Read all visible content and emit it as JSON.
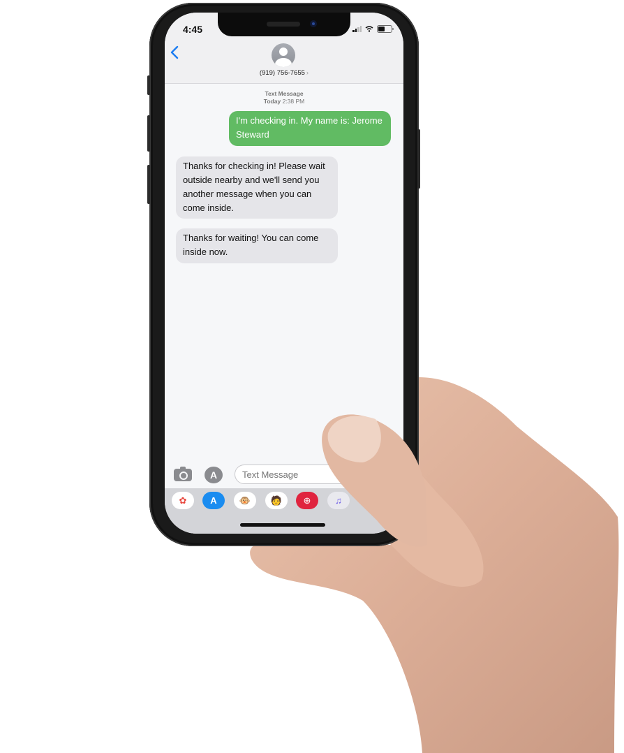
{
  "status_bar": {
    "time": "4:45",
    "signal_bars": 2,
    "battery_level": 0.5
  },
  "header": {
    "back_icon": "chevron-left-icon",
    "contact_icon": "person-avatar-icon",
    "contact_name": "(919) 756-7655",
    "contact_chevron": "›"
  },
  "conversation": {
    "meta_label": "Text Message",
    "meta_day": "Today",
    "meta_time": "2:38 PM",
    "messages": [
      {
        "direction": "outgoing",
        "text": "I'm checking in. My name is: Jerome Steward"
      },
      {
        "direction": "incoming",
        "text": "Thanks for checking in! Please wait outside nearby and we'll send you another message when you can come inside."
      },
      {
        "direction": "incoming",
        "text": "Thanks for waiting! You can come inside now."
      }
    ]
  },
  "composer": {
    "camera_icon": "camera-icon",
    "apps_icon": "app-store-icon",
    "apps_glyph": "A",
    "placeholder": "Text Message"
  },
  "app_drawer": [
    {
      "name": "photos",
      "glyph": "✿",
      "bg": "#ffffff",
      "color": "#e8453c"
    },
    {
      "name": "app-store",
      "glyph": "A",
      "bg": "#1a8cf0",
      "color": "#ffffff"
    },
    {
      "name": "animoji",
      "glyph": "🐵",
      "bg": "#ffffff",
      "color": "#8a5a2b"
    },
    {
      "name": "memoji",
      "glyph": "🧑",
      "bg": "#ffffff",
      "color": "#8a5a2b"
    },
    {
      "name": "image-search",
      "glyph": "⊕",
      "bg": "#e0243f",
      "color": "#ffffff"
    },
    {
      "name": "music",
      "glyph": "♫",
      "bg": "#e9e9ee",
      "color": "#6c5ce7"
    }
  ],
  "colors": {
    "outgoing_bubble": "#61bb63",
    "incoming_bubble": "#e5e5e9",
    "accent": "#1b7cf2"
  }
}
